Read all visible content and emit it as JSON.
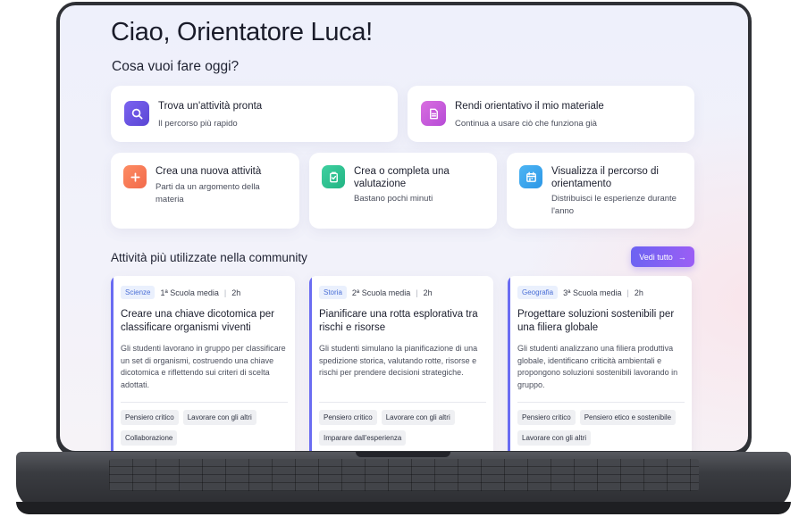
{
  "greeting": "Ciao, Orientatore Luca!",
  "subtitle": "Cosa vuoi fare oggi?",
  "quick_actions": [
    {
      "title": "Trova un'attività pronta",
      "desc": "Il percorso più rapido",
      "icon": "search-icon",
      "color": "#6b55e0"
    },
    {
      "title": "Rendi orientativo il mio materiale",
      "desc": "Continua a usare ciò che funziona già",
      "icon": "document-icon",
      "color": "#c65cdb"
    }
  ],
  "secondary_actions": [
    {
      "title": "Crea una nuova attività",
      "desc": "Parti da un argomento della materia",
      "icon": "plus-icon",
      "color": "#f87b57"
    },
    {
      "title": "Crea o completa una valutazione",
      "desc": "Bastano pochi minuti",
      "icon": "clipboard-icon",
      "color": "#2fc392"
    },
    {
      "title": "Visualizza il percorso di orientamento",
      "desc": "Distribuisci le esperienze durante l'anno",
      "icon": "calendar-icon",
      "color": "#3aa7ef"
    }
  ],
  "community": {
    "title": "Attività più utilizzate nella community",
    "view_all": "Vedi tutto",
    "accent": "#6a6cf2",
    "activities": [
      {
        "subject": "Scienze",
        "level": "1ª Scuola media",
        "duration": "2h",
        "title": "Creare una chiave dicotomica per classificare organismi viventi",
        "desc": "Gli studenti lavorano in gruppo per classificare un set di organismi, costruendo una chiave dicotomica e riflettendo sui criteri di scelta adottati.",
        "tags": [
          "Pensiero critico",
          "Lavorare con gli altri",
          "Collaborazione"
        ]
      },
      {
        "subject": "Storia",
        "level": "2ª Scuola media",
        "duration": "2h",
        "title": "Pianificare una rotta esplorativa tra rischi e risorse",
        "desc": "Gli studenti simulano la pianificazione di una spedizione storica, valutando rotte, risorse e rischi per prendere decisioni strategiche.",
        "tags": [
          "Pensiero critico",
          "Lavorare con gli altri",
          "Imparare dall'esperienza"
        ]
      },
      {
        "subject": "Geografia",
        "level": "3ª Scuola media",
        "duration": "2h",
        "title": "Progettare soluzioni sostenibili per una filiera globale",
        "desc": "Gli studenti analizzano una filiera produttiva globale, identificano criticità ambientali e propongono soluzioni sostenibili lavorando in gruppo.",
        "tags": [
          "Pensiero critico",
          "Pensiero etico e sostenibile",
          "Lavorare con gli altri"
        ]
      }
    ]
  }
}
